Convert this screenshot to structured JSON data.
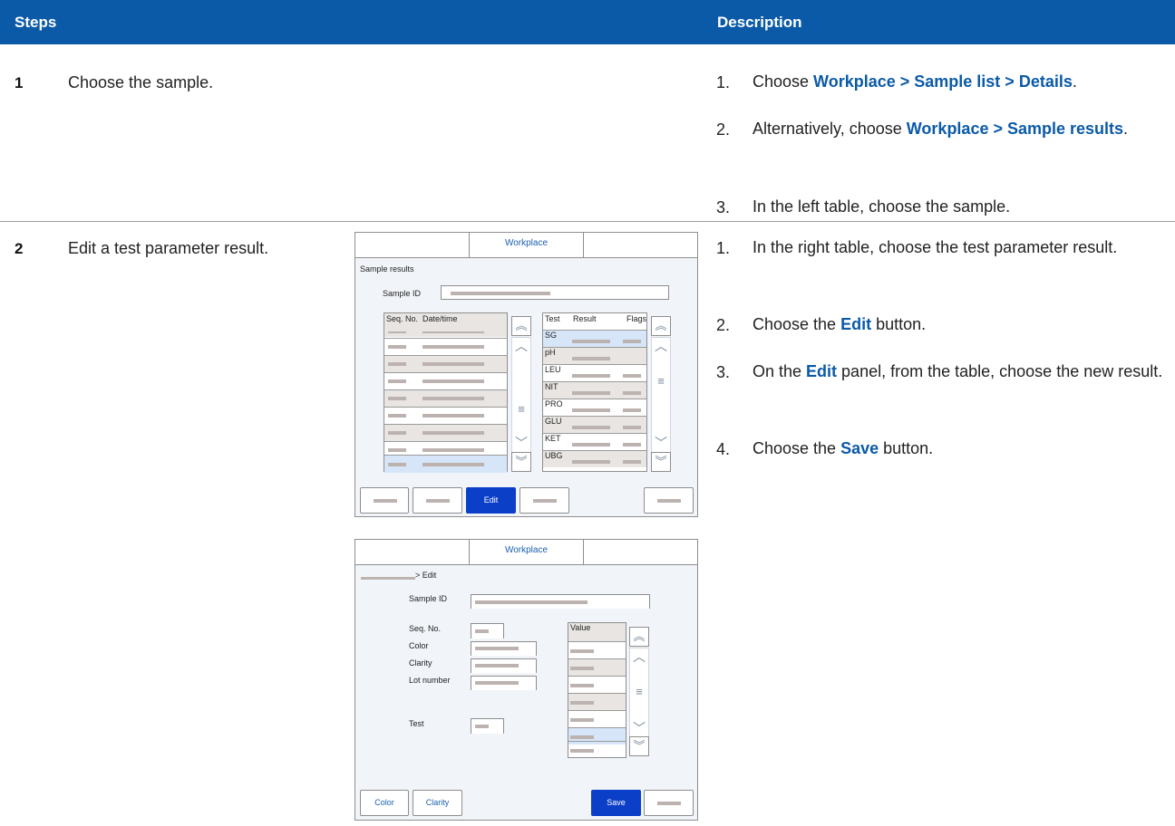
{
  "header": {
    "steps": "Steps",
    "description": "Description"
  },
  "steps": [
    {
      "number": "1",
      "text": "Choose the sample."
    },
    {
      "number": "2",
      "text": "Edit a test parameter result."
    }
  ],
  "step1_desc": [
    {
      "n": "1.",
      "pre": "Choose ",
      "bold": "Workplace > Sample list > Details",
      "post": "."
    },
    {
      "n": "2.",
      "pre": "Alternatively, choose ",
      "bold": "Workplace > Sample results",
      "post": "."
    },
    {
      "n": "3.",
      "pre": "In the left table, choose the sample.",
      "bold": "",
      "post": ""
    }
  ],
  "step2_desc": [
    {
      "n": "1.",
      "pre": "In the right table, choose the test parameter result.",
      "bold": "",
      "post": ""
    },
    {
      "n": "2.",
      "pre": "Choose the ",
      "bold": "Edit",
      "post": " button."
    },
    {
      "n": "3.",
      "pre": "On the ",
      "bold": "Edit",
      "post": " panel, from the table, choose the new result."
    },
    {
      "n": "4.",
      "pre": "Choose the ",
      "bold": "Save",
      "post": " button."
    }
  ],
  "screen1": {
    "tab": "Workplace",
    "title": "Sample results",
    "sample_id_label": "Sample ID",
    "left_cols": {
      "seq": "Seq. No.",
      "datetime": "Date/time"
    },
    "right_cols": {
      "test": "Test",
      "result": "Result",
      "flags": "Flags"
    },
    "tests": [
      "SG",
      "pH",
      "LEU",
      "NIT",
      "PRO",
      "GLU",
      "KET",
      "UBG"
    ],
    "edit_button": "Edit"
  },
  "screen2": {
    "tab": "Workplace",
    "breadcrumb": "> Edit",
    "sample_id_label": "Sample ID",
    "seq_label": "Seq. No.",
    "color_label": "Color",
    "clarity_label": "Clarity",
    "lot_label": "Lot number",
    "test_label": "Test",
    "value_col": "Value",
    "color_button": "Color",
    "clarity_button": "Clarity",
    "save_button": "Save"
  },
  "icons": {
    "up_double": "double-chevron-up-icon",
    "up": "chevron-up-icon",
    "menu": "menu-icon",
    "down": "chevron-down-icon",
    "down_double": "double-chevron-down-icon"
  },
  "colors": {
    "header": "#0b5aa8",
    "primary_button": "#0b3fc8",
    "link_text": "#0b5aa8"
  }
}
